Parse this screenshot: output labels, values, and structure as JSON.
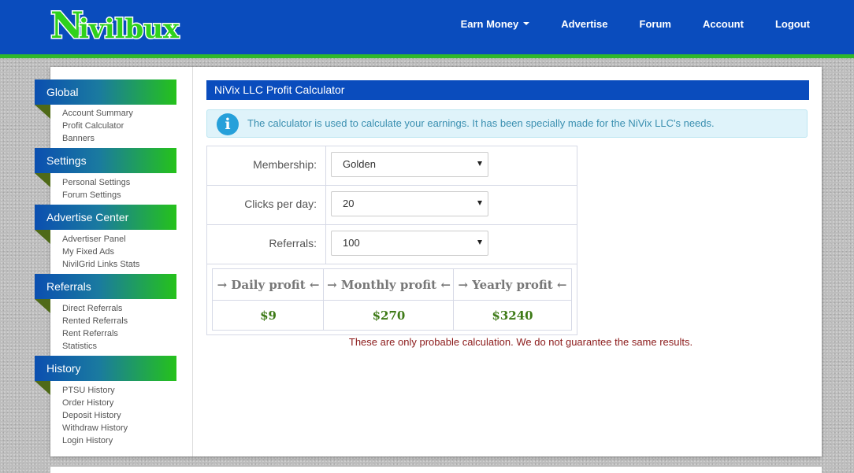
{
  "brand": {
    "logo_text": "Nivilbux",
    "colors": {
      "nav": "#0a4cbd",
      "accent": "#2fb82a"
    }
  },
  "nav": {
    "items": [
      {
        "label": "Earn Money",
        "dropdown": true
      },
      {
        "label": "Advertise"
      },
      {
        "label": "Forum"
      },
      {
        "label": "Account"
      },
      {
        "label": "Logout"
      }
    ]
  },
  "sidebar": {
    "sections": [
      {
        "title": "Global",
        "links": [
          "Account Summary",
          "Profit Calculator",
          "Banners"
        ]
      },
      {
        "title": "Settings",
        "links": [
          "Personal Settings",
          "Forum Settings"
        ]
      },
      {
        "title": "Advertise Center",
        "links": [
          "Advertiser Panel",
          "My Fixed Ads",
          "NivilGrid Links Stats"
        ]
      },
      {
        "title": "Referrals",
        "links": [
          "Direct Referrals",
          "Rented Referrals",
          "Rent Referrals",
          "Statistics"
        ]
      },
      {
        "title": "History",
        "links": [
          "PTSU History",
          "Order History",
          "Deposit History",
          "Withdraw History",
          "Login History"
        ]
      }
    ]
  },
  "calculator": {
    "title": "NiVix LLC Profit Calculator",
    "info": "The calculator is used to calculate your earnings. It has been specially made for the NiVix LLC's needs.",
    "info_icon": "info-icon",
    "fields": [
      {
        "label": "Membership:",
        "value": "Golden"
      },
      {
        "label": "Clicks per day:",
        "value": "20"
      },
      {
        "label": "Referrals:",
        "value": "100"
      }
    ],
    "results": {
      "headers": [
        "→ Daily profit ←",
        "→ Monthly profit ←",
        "→ Yearly profit ←"
      ],
      "values": [
        "$9",
        "$270",
        "$3240"
      ]
    },
    "disclaimer": "These are only probable calculation. We do not guarantee the same results."
  }
}
